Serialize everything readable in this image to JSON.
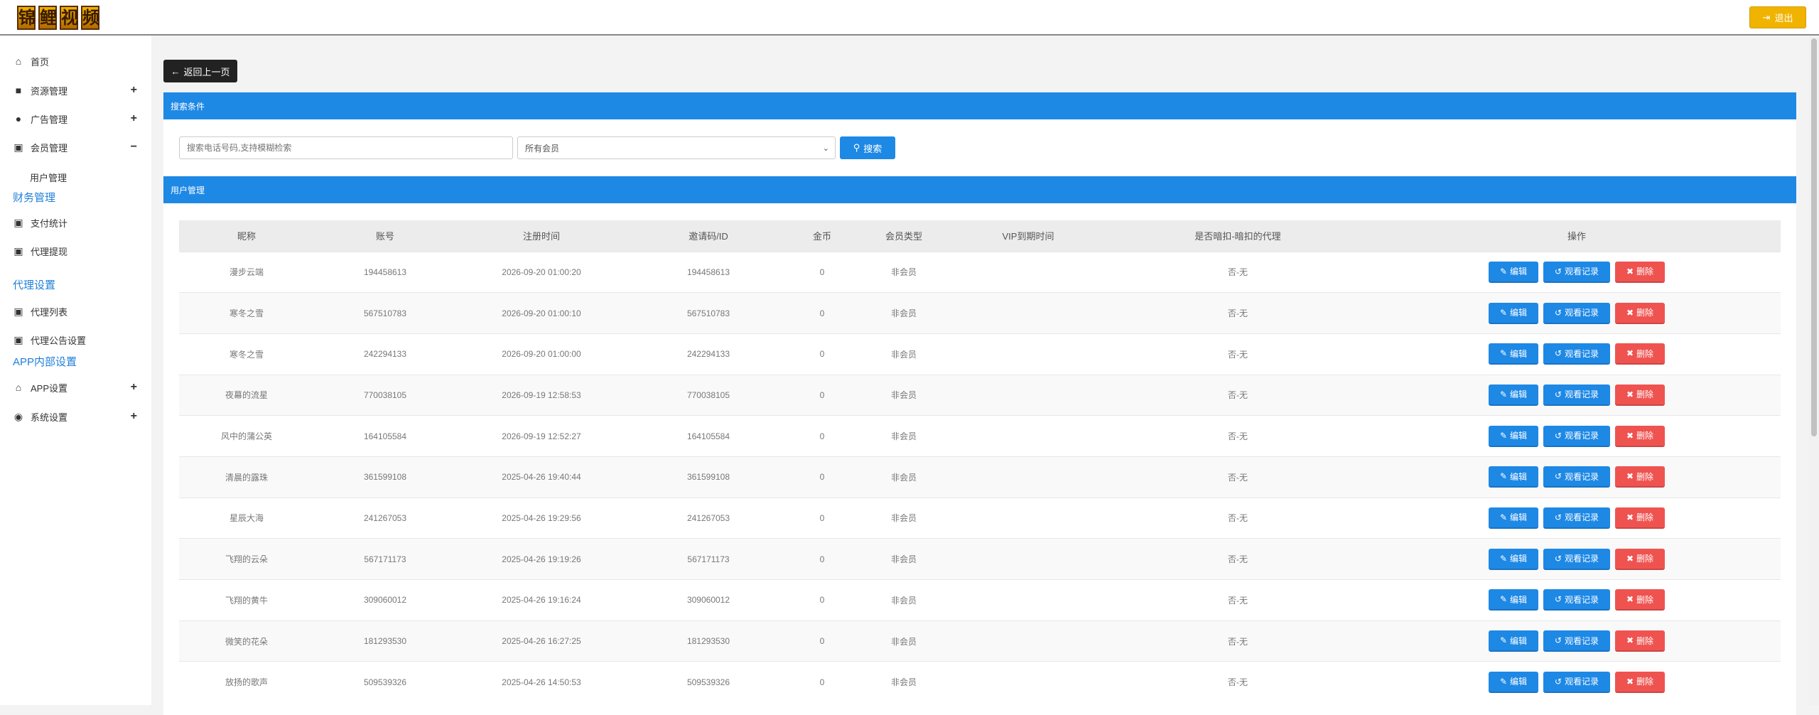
{
  "header": {
    "logo_chars": [
      "锦",
      "鲤",
      "视",
      "频"
    ],
    "logout_label": "退出",
    "accent": "#f0b400"
  },
  "sidebar": {
    "home": "首页",
    "resources": "资源管理",
    "ads": "广告管理",
    "members": "会员管理",
    "members_sub": "用户管理",
    "finance_section": "财务管理",
    "pay_stats": "支付统计",
    "agent_withdraw": "代理提现",
    "agent_section": "代理设置",
    "agent_list": "代理列表",
    "agent_notice": "代理公告设置",
    "app_section": "APP内部设置",
    "app_settings": "APP设置",
    "system_settings": "系统设置"
  },
  "main": {
    "back_label": "返回上一页",
    "search_panel_title": "搜索条件",
    "search_placeholder": "搜索电话号码,支持模糊检索",
    "member_filter_value": "所有会员",
    "search_label": "搜索",
    "users_panel_title": "用户管理"
  },
  "table": {
    "headers": [
      "昵称",
      "账号",
      "注册时间",
      "邀请码/ID",
      "金币",
      "会员类型",
      "VIP到期时间",
      "是否暗扣-暗扣的代理",
      "操作"
    ],
    "edit_label": "编辑",
    "view_label": "观看记录",
    "delete_label": "删除",
    "rows": [
      {
        "nick": "漫步云端",
        "account": "194458613",
        "reg": "2026-09-20 01:00:20",
        "code": "194458613",
        "coins": "0",
        "type": "非会员",
        "vip": "",
        "deduct": "否-无"
      },
      {
        "nick": "寒冬之雪",
        "account": "567510783",
        "reg": "2026-09-20 01:00:10",
        "code": "567510783",
        "coins": "0",
        "type": "非会员",
        "vip": "",
        "deduct": "否-无"
      },
      {
        "nick": "寒冬之雪",
        "account": "242294133",
        "reg": "2026-09-20 01:00:00",
        "code": "242294133",
        "coins": "0",
        "type": "非会员",
        "vip": "",
        "deduct": "否-无"
      },
      {
        "nick": "夜幕的流星",
        "account": "770038105",
        "reg": "2026-09-19 12:58:53",
        "code": "770038105",
        "coins": "0",
        "type": "非会员",
        "vip": "",
        "deduct": "否-无"
      },
      {
        "nick": "风中的蒲公英",
        "account": "164105584",
        "reg": "2026-09-19 12:52:27",
        "code": "164105584",
        "coins": "0",
        "type": "非会员",
        "vip": "",
        "deduct": "否-无"
      },
      {
        "nick": "清晨的露珠",
        "account": "361599108",
        "reg": "2025-04-26 19:40:44",
        "code": "361599108",
        "coins": "0",
        "type": "非会员",
        "vip": "",
        "deduct": "否-无"
      },
      {
        "nick": "星辰大海",
        "account": "241267053",
        "reg": "2025-04-26 19:29:56",
        "code": "241267053",
        "coins": "0",
        "type": "非会员",
        "vip": "",
        "deduct": "否-无"
      },
      {
        "nick": "飞翔的云朵",
        "account": "567171173",
        "reg": "2025-04-26 19:19:26",
        "code": "567171173",
        "coins": "0",
        "type": "非会员",
        "vip": "",
        "deduct": "否-无"
      },
      {
        "nick": "飞翔的黄牛",
        "account": "309060012",
        "reg": "2025-04-26 19:16:24",
        "code": "309060012",
        "coins": "0",
        "type": "非会员",
        "vip": "",
        "deduct": "否-无"
      },
      {
        "nick": "微笑的花朵",
        "account": "181293530",
        "reg": "2025-04-26 16:27:25",
        "code": "181293530",
        "coins": "0",
        "type": "非会员",
        "vip": "",
        "deduct": "否-无"
      },
      {
        "nick": "放扬的歌声",
        "account": "509539326",
        "reg": "2025-04-26 14:50:53",
        "code": "509539326",
        "coins": "0",
        "type": "非会员",
        "vip": "",
        "deduct": "否-无"
      }
    ]
  },
  "colors": {
    "primary": "#1e88e5",
    "danger": "#ef5350",
    "section_link": "#1e7fd8"
  }
}
